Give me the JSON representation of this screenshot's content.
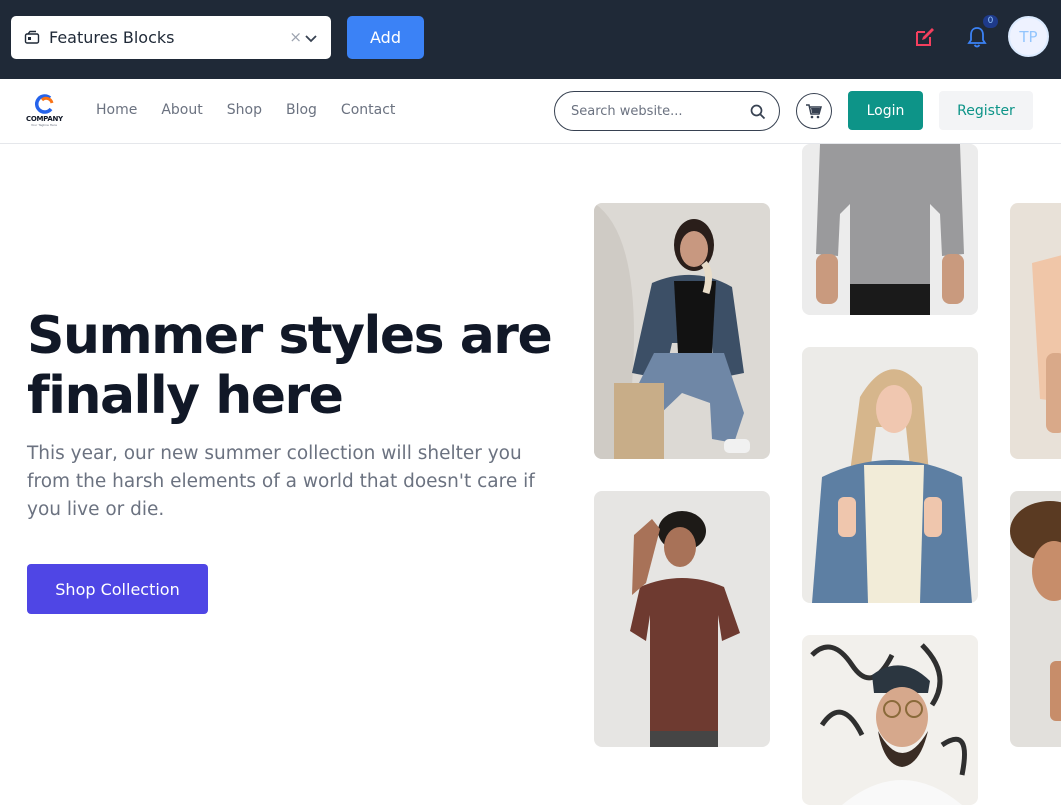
{
  "editor_bar": {
    "block_select_value": "Features Blocks",
    "clear_symbol": "×",
    "add_label": "Add",
    "notification_count": "0",
    "avatar_initials": "TP",
    "edit_icon": "edit-icon",
    "bell_icon": "bell-icon",
    "accent_color": "#3b82f6",
    "edit_color": "#f43f5e"
  },
  "site_header": {
    "logo_name": "COMPANY",
    "logo_tagline": "Your Tagline Here",
    "nav": [
      "Home",
      "About",
      "Shop",
      "Blog",
      "Contact"
    ],
    "search_placeholder": "Search website...",
    "login_label": "Login",
    "register_label": "Register",
    "login_color": "#0d9488"
  },
  "hero": {
    "title": "Summer styles are finally here",
    "subtitle": "This year, our new summer collection will shelter you from the harsh elements of a world that doesn't care if you live or die.",
    "cta_label": "Shop Collection",
    "cta_color": "#4f46e5"
  },
  "gallery": {
    "images": [
      "model-gray-tee",
      "model-denim-jacket-black-top",
      "model-denim-jacket-cream-top",
      "model-brown-tee",
      "model-beanie-glasses",
      "model-peach-tee",
      "model-curly-hair"
    ]
  }
}
